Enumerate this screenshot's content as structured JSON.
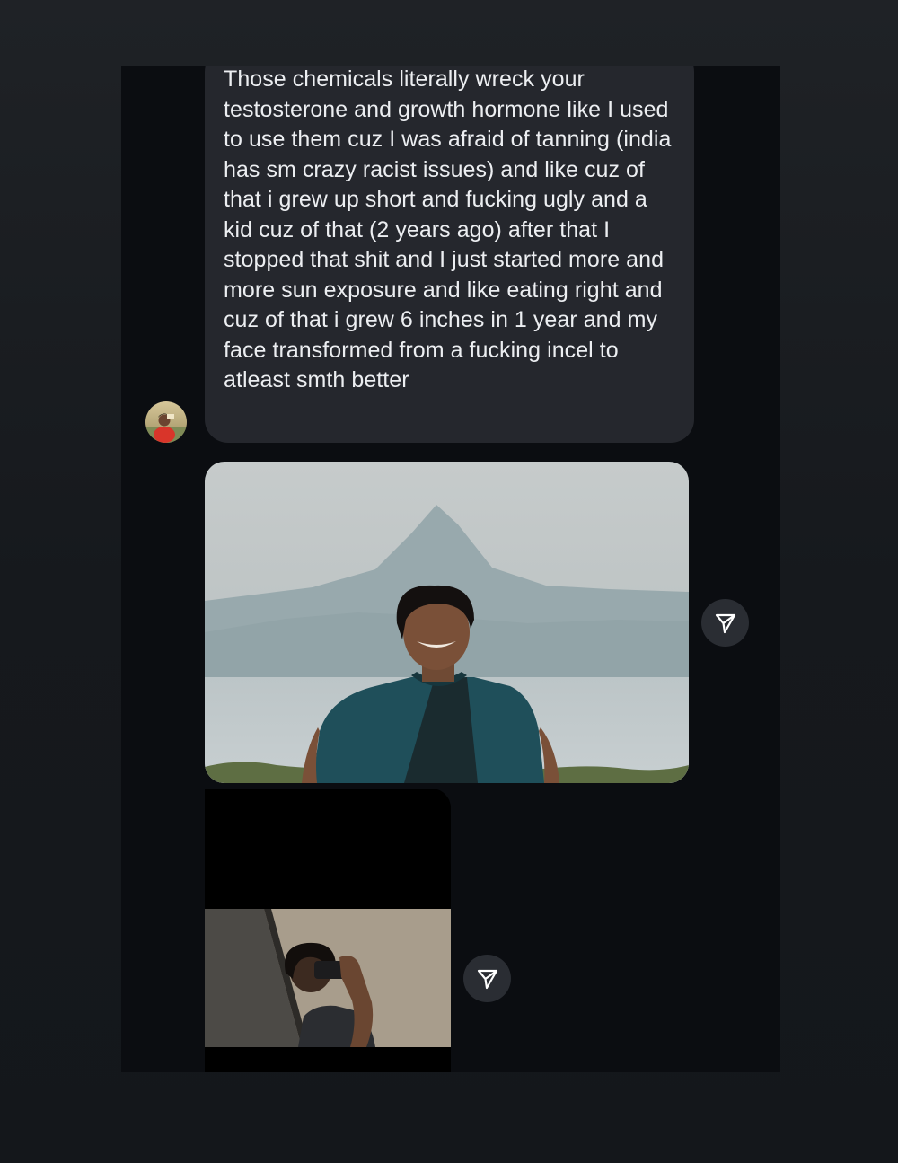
{
  "thread": {
    "message": {
      "text": "Those chemicals literally wreck your testosterone and growth hormone like I used to use them cuz I was afraid of tanning (india has sm crazy racist issues) and like cuz of that i grew up short and fucking ugly and a kid cuz of that (2 years ago) after that I stopped that shit and I just started more and more sun exposure and like eating right and cuz of that i grew 6 inches in 1 year and my face transformed from a fucking incel to atleast smth better"
    },
    "sender_avatar": {
      "icon": "avatar-photo"
    },
    "photos": [
      {
        "icon": "photo-boy-mountain-lake"
      },
      {
        "icon": "photo-mirror-selfie"
      }
    ],
    "share_icons": [
      "paper-plane-icon",
      "paper-plane-icon"
    ]
  },
  "colors": {
    "page_background": "#1a1d21",
    "chat_background": "#0b0d11",
    "bubble_background": "#25272d",
    "bubble_text": "#eceef1",
    "share_button": "#2a2d33"
  }
}
